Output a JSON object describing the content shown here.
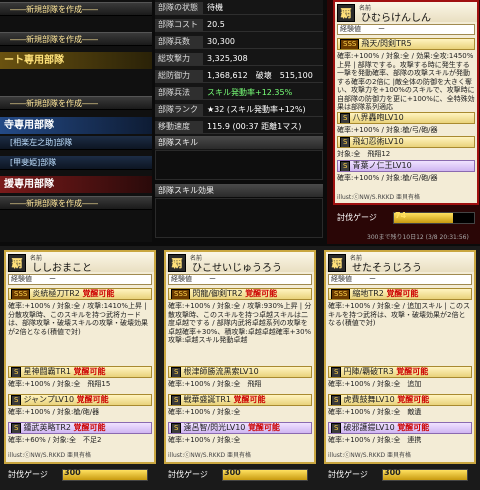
{
  "left_menu": {
    "new_unit_1": "――新規部隊を作成――",
    "new_unit_2": "――新規部隊を作成――",
    "header_gold": "ート専用部隊",
    "new_unit_3": "――新規部隊を作成――",
    "header_blue": "寺専用部隊",
    "sub1": "[相楽左之助]部隊",
    "sub2": "[甲斐姫]部隊",
    "header_red": "援専用部隊",
    "new_unit_4": "――新規部隊を作成――"
  },
  "status": {
    "rows": [
      {
        "label": "部隊の状態",
        "value": "待機"
      },
      {
        "label": "部隊コスト",
        "value": "20.5"
      },
      {
        "label": "部隊兵数",
        "value": "30,300"
      },
      {
        "label": "総攻撃力",
        "value": "3,325,308"
      },
      {
        "label": "総防御力",
        "value": "1,368,612　破壊　515,100"
      },
      {
        "label": "部隊兵法",
        "value": "スキル発動率+12.35%"
      },
      {
        "label": "部隊ランク",
        "value": "★32 (スキル発動率+12%)"
      },
      {
        "label": "移動速度",
        "value": "115.9 (00:37 距離1マス)"
      }
    ],
    "section_skill": "部隊スキル",
    "section_effect": "部隊スキル効果"
  },
  "cards": {
    "top": {
      "rarity": "覇",
      "name_label": "名前",
      "name": "ひむらけんしん",
      "xp_label": "経験値",
      "xp_value": "ー",
      "skill1": "飛天/閃剣TR5",
      "desc1": "確率:+100% / 対象:全 / 効果:全攻:1450%上昇 | 部隊でする。攻撃する時に発生する一撃を発動確率、部隊の攻撃スキルが発動する確率の2倍に |敵全体の防御を大きく奪い、攻撃力を+100%のスキルで、攻撃時に自部隊の防御力を更に+100%に、全特殊効果は部隊系列適応",
      "skill2": "八界轟咆LV10",
      "skill2_line": "確率:+100% / 対象:槍/弓/砲/器",
      "skill3": "飛幻忍術LV10",
      "skill3_line": "対象:全　飛翔12",
      "skill4": "青葉ノ仁王LV10",
      "skill4_line": "確率:+100% / 対象:槍/弓/砲/器",
      "credit": "illust:ⓒNW/S.RKKD 亜貝有格",
      "gauge_label": "討伐ゲージ",
      "gauge_value": "74",
      "gauge_fraction": 0.74,
      "footnote": "300まで残り10日12 (3/8 20:31:56)"
    },
    "bottom": [
      {
        "rarity": "覇",
        "name_label": "名前",
        "name": "ししおまこと",
        "xp_label": "経験値",
        "xp_value": "ー",
        "skill1": "炎統極刀TR2",
        "skill1_tag": "覚醒可能",
        "desc1": "確率:+100% / 対象:全 / 攻撃:1410%上昇 | 分散攻撃時、このスキルを持つ武将カードは、部隊攻撃・破壊スキルの攻撃・破壊効果が2倍となる(積値で対)",
        "skill2": "星神闘霸TR1",
        "skill2_tag": "覚醒可能",
        "skill2_line": "確率:+100% / 対象:全　飛翔15",
        "skill3": "ジャンプLV10",
        "skill3_tag": "覚醒可能",
        "skill3_line": "確率:+100% / 対象:槍/砲/器",
        "skill4": "鍾武英略TR2",
        "skill4_tag": "覚醒可能",
        "skill4_line": "確率:+60% / 対象:全　不足2",
        "credit": "illust:ⓒNW/S.RKKD 亜貝有格",
        "gauge_label": "討伐ゲージ",
        "gauge_value": "300",
        "gauge_fraction": 1.0
      },
      {
        "rarity": "覇",
        "name_label": "名前",
        "name": "ひこせいじゅうろう",
        "xp_label": "経験値",
        "xp_value": "ー",
        "skill1": "閃龍/御剣TR2",
        "skill1_tag": "覚醒可能",
        "desc1": "確率:+100% / 対象:全 / 攻撃:930%上昇 | 分散攻撃時、このスキルを持つ卓越スキルは二度卓越でする / 部隊内武将卓越系列の攻撃を卓越確率+30%、積攻撃:卓越卓越確率+30% 攻撃:卓越スキル発動卓越",
        "skill2": "根津師勝流黒索LV10",
        "skill2_line": "確率:+100% / 対象:全　飛翔",
        "skill3": "戦華盛誕TR1",
        "skill3_tag": "覚醒可能",
        "skill3_line": "確率:+100% / 対象:全",
        "skill4": "遠呂智/閃光LV10",
        "skill4_tag": "覚醒可能",
        "skill4_line": "確率:+100% / 対象:全",
        "credit": "illust:ⓒNW/S.RKKD 亜貝有格",
        "gauge_label": "討伐ゲージ",
        "gauge_value": "300",
        "gauge_fraction": 1.0
      },
      {
        "rarity": "覇",
        "name_label": "名前",
        "name": "せたそうじろう",
        "xp_label": "経験値",
        "xp_value": "ー",
        "skill1": "縮地TR2",
        "skill1_tag": "覚醒可能",
        "desc1": "確率:+100% / 対象:全 / 追加スキル | このスキルを持つ武将は、攻撃・破壊効果が2倍となる(積値で対)",
        "skill2": "円陣/覇破TR3",
        "skill2_tag": "覚醒可能",
        "skill2_line": "確率:+100% / 対象:全　追加",
        "skill3": "虎費鼓舞LV10",
        "skill3_tag": "覚醒可能",
        "skill3_line": "確率:+100% / 対象:全　敵遺",
        "skill4": "破邪護鎧LV10",
        "skill4_tag": "覚醒可能",
        "skill4_line": "確率:+100% / 対象:全　連携",
        "credit": "illust:ⓒNW/S.RKKD 亜貝有格",
        "gauge_label": "討伐ゲージ",
        "gauge_value": "300",
        "gauge_fraction": 1.0
      }
    ]
  },
  "colors": {
    "gold": "#c9a640",
    "red_border": "#a01010",
    "gauge": "#ffe060"
  }
}
